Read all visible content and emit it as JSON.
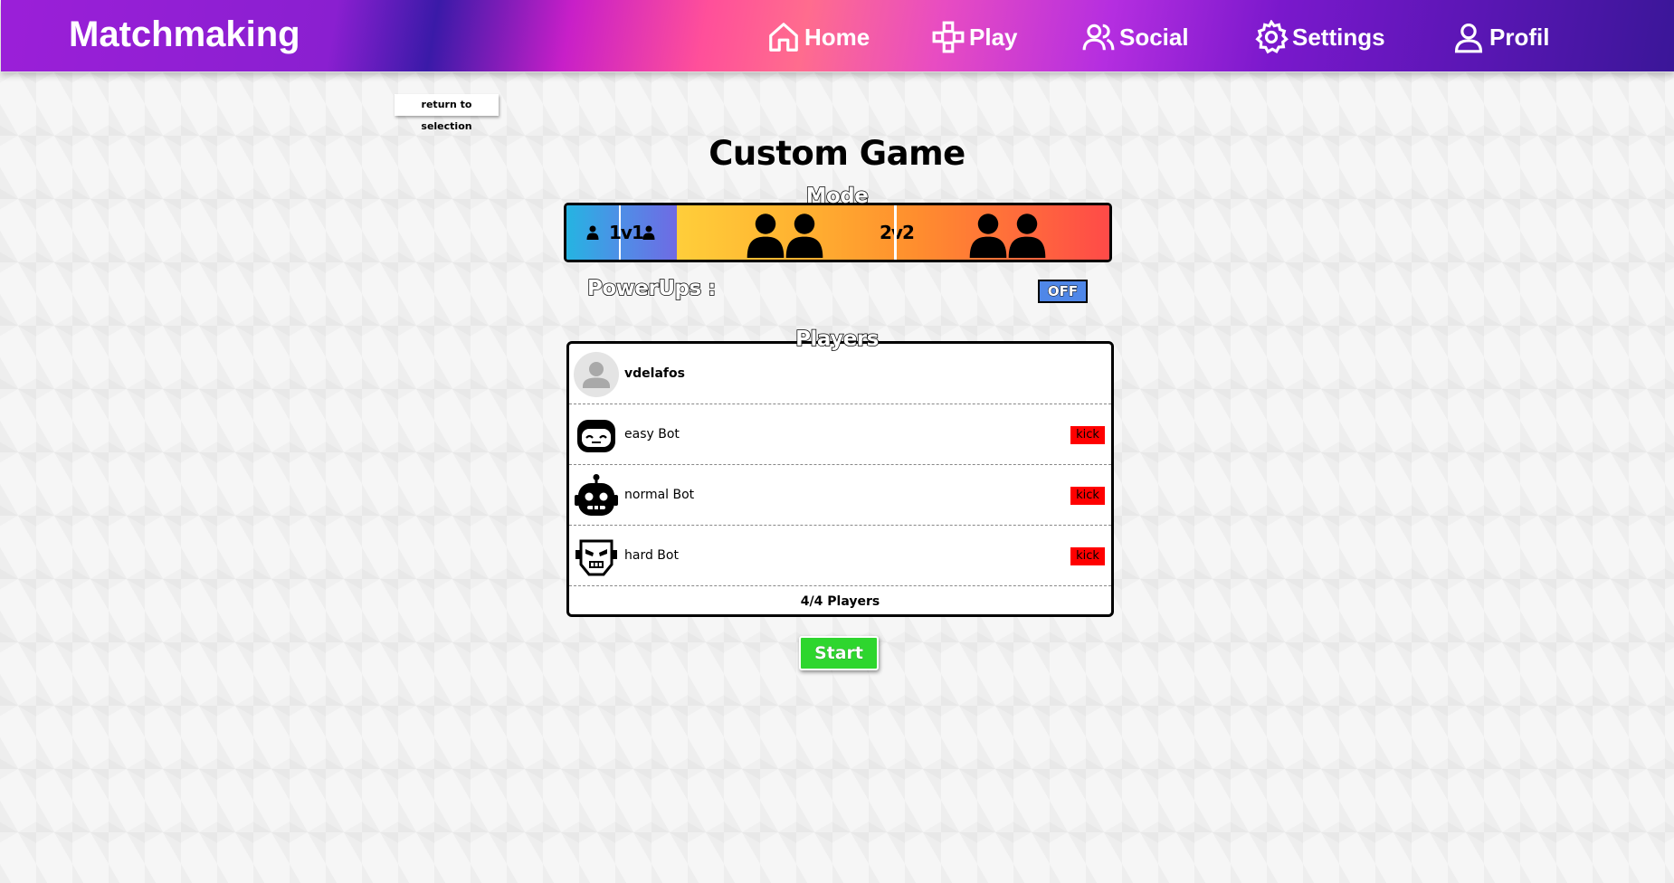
{
  "navbar": {
    "brand": "Matchmaking",
    "items": [
      {
        "label": "Home",
        "icon": "home-icon"
      },
      {
        "label": "Play",
        "icon": "gamepad-icon"
      },
      {
        "label": "Social",
        "icon": "users-icon"
      },
      {
        "label": "Settings",
        "icon": "gear-icon"
      },
      {
        "label": "Profil",
        "icon": "user-icon"
      }
    ]
  },
  "return_label": "return to selection",
  "title": "Custom Game",
  "mode": {
    "label": "Mode",
    "options": [
      "1v1",
      "2v2"
    ]
  },
  "powerups": {
    "label": "PowerUps :",
    "state": "OFF"
  },
  "players": {
    "label": "Players",
    "list": [
      {
        "name": "vdelafos",
        "avatar": "default-avatar-icon",
        "kick": ""
      },
      {
        "name": "easy Bot",
        "avatar": "easy-bot-icon",
        "kick": "kick"
      },
      {
        "name": "normal Bot",
        "avatar": "normal-bot-icon",
        "kick": "kick"
      },
      {
        "name": "hard Bot",
        "avatar": "hard-bot-icon",
        "kick": "kick"
      }
    ],
    "count": "4/4 Players"
  },
  "start_label": "Start",
  "colors": {
    "kick": "#ff0000",
    "start": "#2ed62e",
    "powerups_off": "#4f87e8"
  }
}
